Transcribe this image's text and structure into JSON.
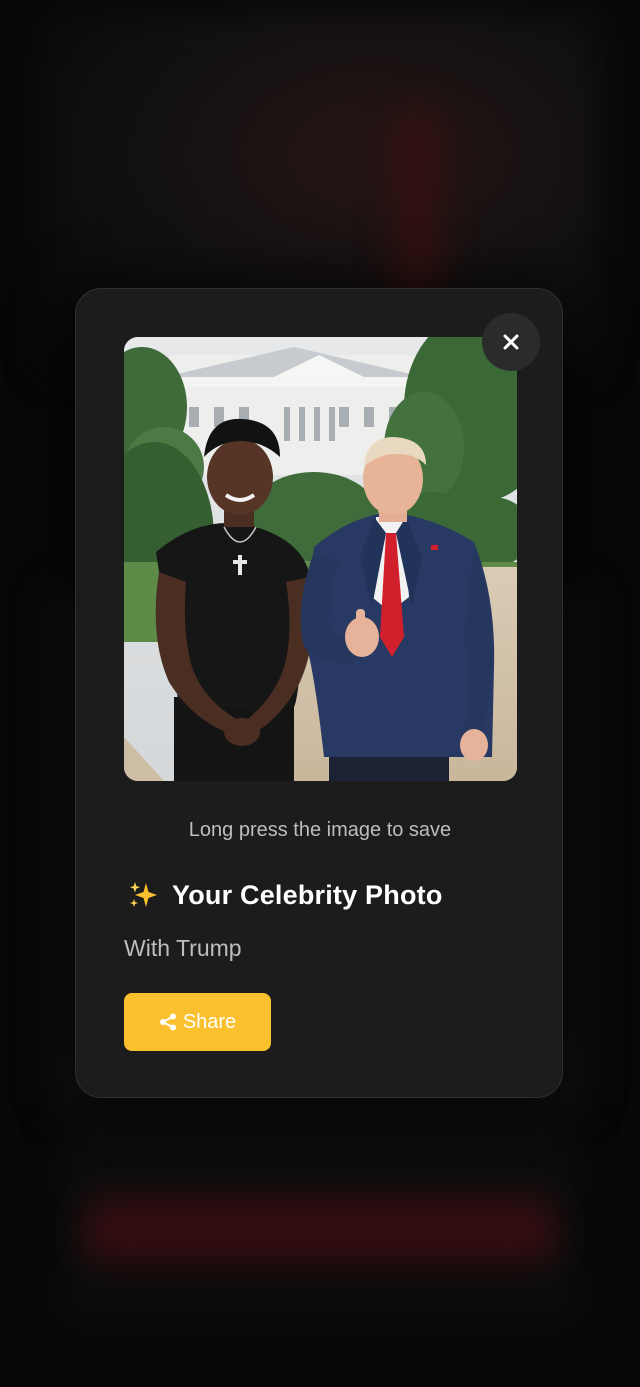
{
  "modal": {
    "hint": "Long press the image to save",
    "title": "Your Celebrity Photo",
    "subtitle": "With Trump",
    "share_label": "Share",
    "close_icon": "close-icon",
    "sparkle_icon": "sparkles-icon",
    "share_icon": "share-icon"
  },
  "colors": {
    "modal_bg": "#1c1c1c",
    "accent": "#fbc02d",
    "hint_text": "#bdbdbd",
    "title_text": "#ffffff"
  }
}
